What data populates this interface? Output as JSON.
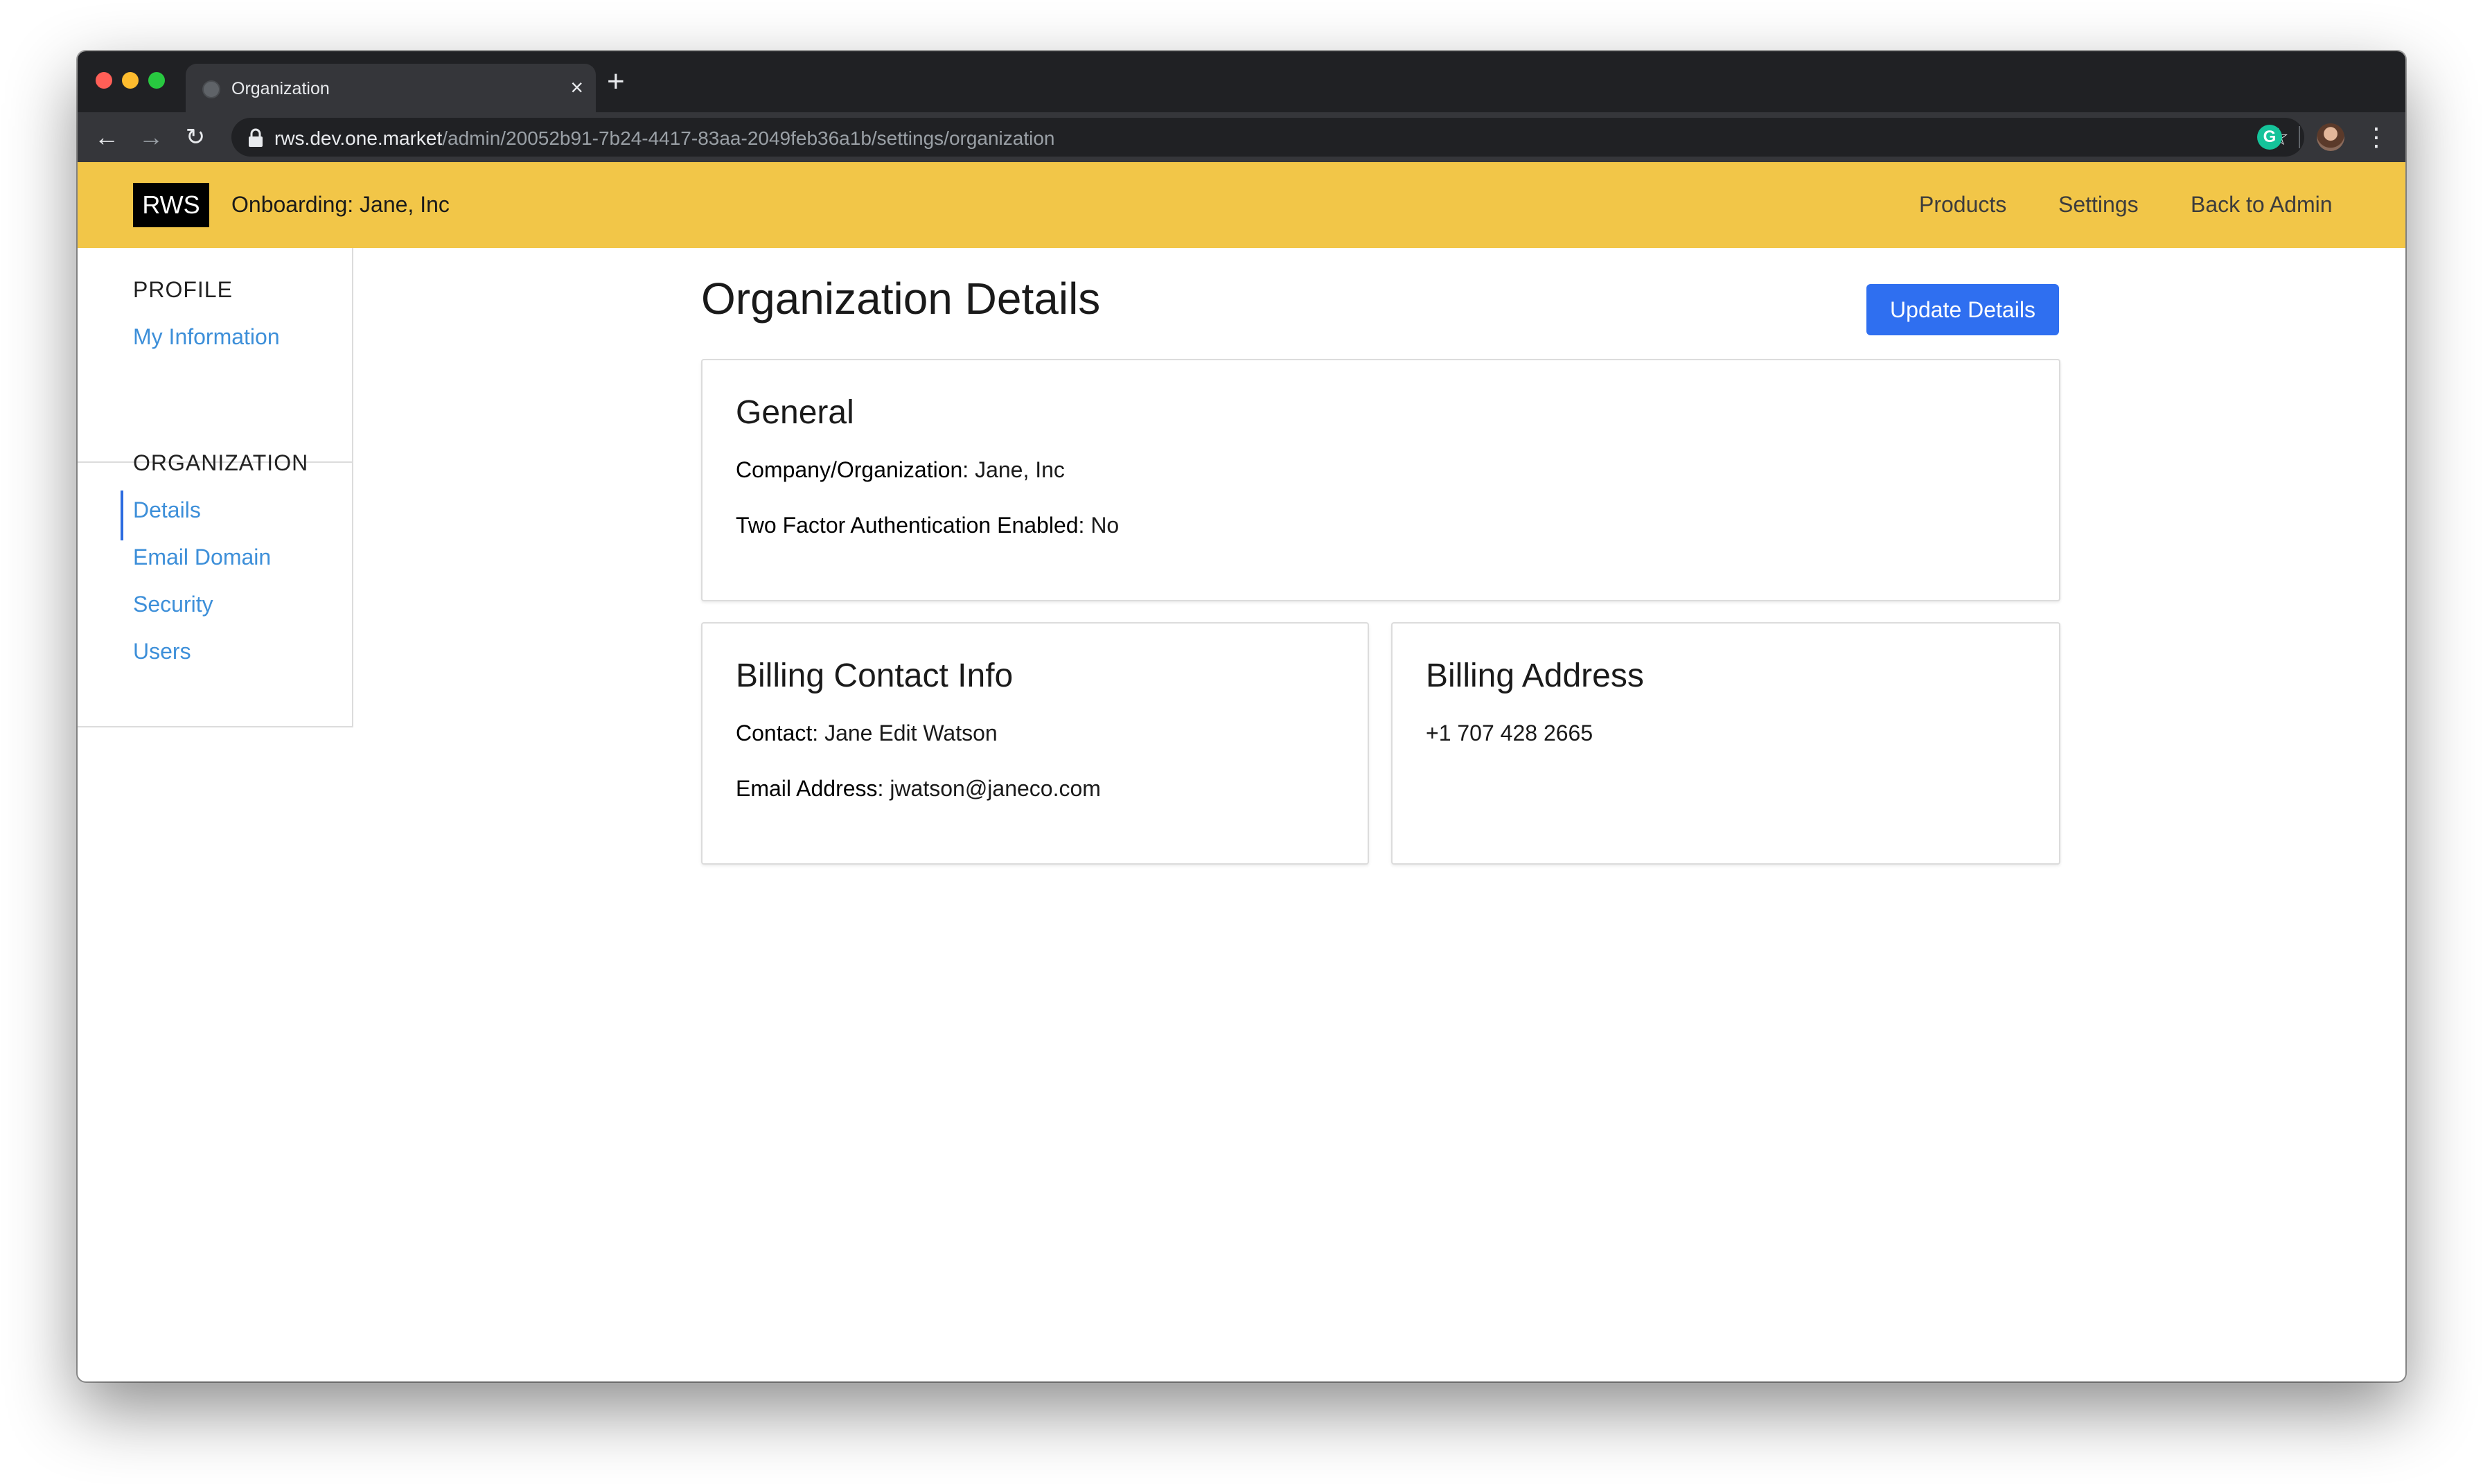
{
  "browser": {
    "tab_title": "Organization",
    "tab_close": "×",
    "new_tab": "+",
    "url_host": "rws.dev.one.market",
    "url_path": "/admin/20052b91-7b24-4417-83aa-2049feb36a1b/settings/organization",
    "extension_letter": "G"
  },
  "header": {
    "logo": "RWS",
    "onboarding": "Onboarding: Jane, Inc",
    "nav": {
      "products": "Products",
      "settings": "Settings",
      "back_to_admin": "Back to Admin"
    },
    "background_color": "#f2c648"
  },
  "sidebar": {
    "profile_heading": "PROFILE",
    "profile_items": [
      {
        "label": "My Information"
      }
    ],
    "organization_heading": "ORGANIZATION",
    "organization_items": [
      {
        "label": "Details",
        "active": true
      },
      {
        "label": "Email Domain"
      },
      {
        "label": "Security"
      },
      {
        "label": "Users"
      }
    ],
    "link_color": "#3d8fd9"
  },
  "main": {
    "title": "Organization Details",
    "update_button": "Update Details",
    "accent_color": "#2f6ff0",
    "general": {
      "title": "General",
      "company_label": "Company/Organization:",
      "company_value": " Jane, Inc",
      "twofa_label": "Two Factor Authentication Enabled:",
      "twofa_value": " No"
    },
    "billing_contact": {
      "title": "Billing Contact Info",
      "contact_label": "Contact:",
      "contact_value": " Jane Edit Watson",
      "email_label": "Email Address:",
      "email_value": " jwatson@janeco.com"
    },
    "billing_address": {
      "title": "Billing Address",
      "phone": "+1 707 428 2665"
    }
  }
}
